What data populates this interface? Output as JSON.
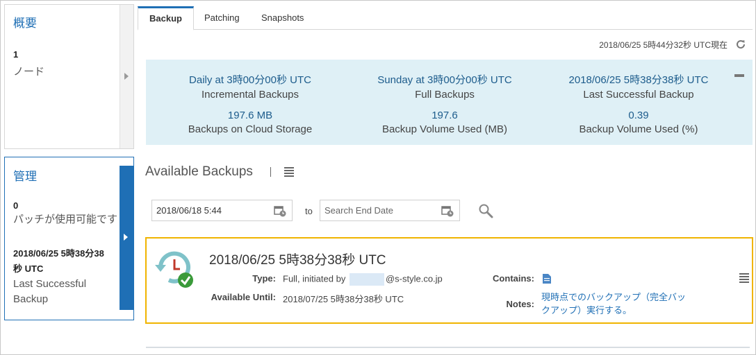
{
  "overview": {
    "title": "概要",
    "count": "1",
    "label": "ノード"
  },
  "manage": {
    "title": "管理",
    "count": "0",
    "label": "パッチが使用可能です",
    "last_date_line1": "2018/06/25 5時38分38",
    "last_date_line2": "秒 UTC",
    "last_label_line1": "Last Successful",
    "last_label_line2": "Backup"
  },
  "tabs": [
    {
      "label": "Backup",
      "active": true
    },
    {
      "label": "Patching",
      "active": false
    },
    {
      "label": "Snapshots",
      "active": false
    }
  ],
  "timestamp": "2018/06/25 5時44分32秒 UTC現在",
  "summary": {
    "incremental_value": "Daily at 3時00分00秒 UTC",
    "incremental_label": "Incremental Backups",
    "full_value": "Sunday at 3時00分00秒 UTC",
    "full_label": "Full Backups",
    "last_value": "2018/06/25 5時38分38秒 UTC",
    "last_label": "Last Successful Backup",
    "storage_value": "197.6 MB",
    "storage_label": "Backups on Cloud Storage",
    "volume_mb_value": "197.6",
    "volume_mb_label": "Backup Volume Used (MB)",
    "volume_pct_value": "0.39",
    "volume_pct_label": "Backup Volume Used (%)"
  },
  "available": {
    "title": "Available Backups"
  },
  "filters": {
    "start_value": "2018/06/18 5:44",
    "to_label": "to",
    "end_placeholder": "Search End Date"
  },
  "backup": {
    "title": "2018/06/25 5時38分38秒 UTC",
    "type_label": "Type:",
    "type_value_prefix": "Full, initiated by",
    "type_value_suffix": "@s-style.co.jp",
    "until_label": "Available Until:",
    "until_value": "2018/07/25 5時38分38秒 UTC",
    "contains_label": "Contains:",
    "notes_label": "Notes:",
    "notes_line1": "現時点でのバックアップ（完全バッ",
    "notes_line2": "クアップ）実行する。"
  },
  "colors": {
    "accent": "#1f6fb5",
    "summary_bg": "#dff0f6",
    "highlight": "#f0b400",
    "success": "#3a9a3a"
  }
}
